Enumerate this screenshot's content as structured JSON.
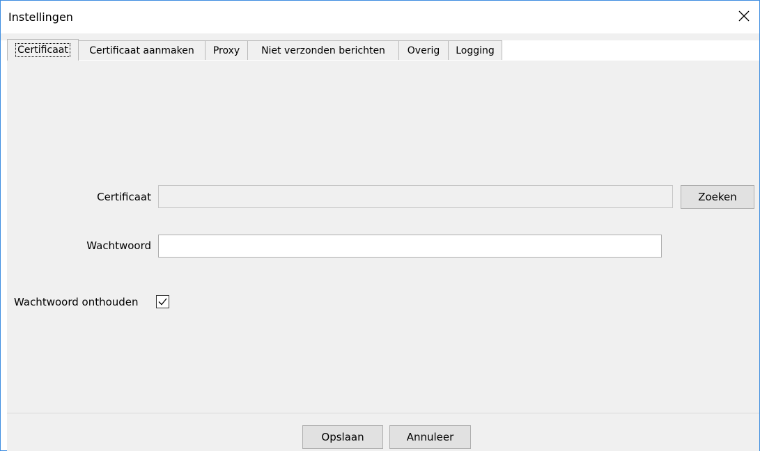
{
  "window": {
    "title": "Instellingen"
  },
  "tabs": [
    {
      "label": "Certificaat"
    },
    {
      "label": "Certificaat aanmaken"
    },
    {
      "label": "Proxy"
    },
    {
      "label": "Niet verzonden berichten"
    },
    {
      "label": "Overig"
    },
    {
      "label": "Logging"
    }
  ],
  "form": {
    "certificate_label": "Certificaat",
    "certificate_value": "",
    "search_button": "Zoeken",
    "password_label": "Wachtwoord",
    "password_value": "",
    "remember_label": "Wachtwoord onthouden",
    "remember_checked": true
  },
  "footer": {
    "save_button": "Opslaan",
    "cancel_button": "Annuleer"
  },
  "icons": {
    "close": "close-icon",
    "check": "checkmark-icon"
  }
}
